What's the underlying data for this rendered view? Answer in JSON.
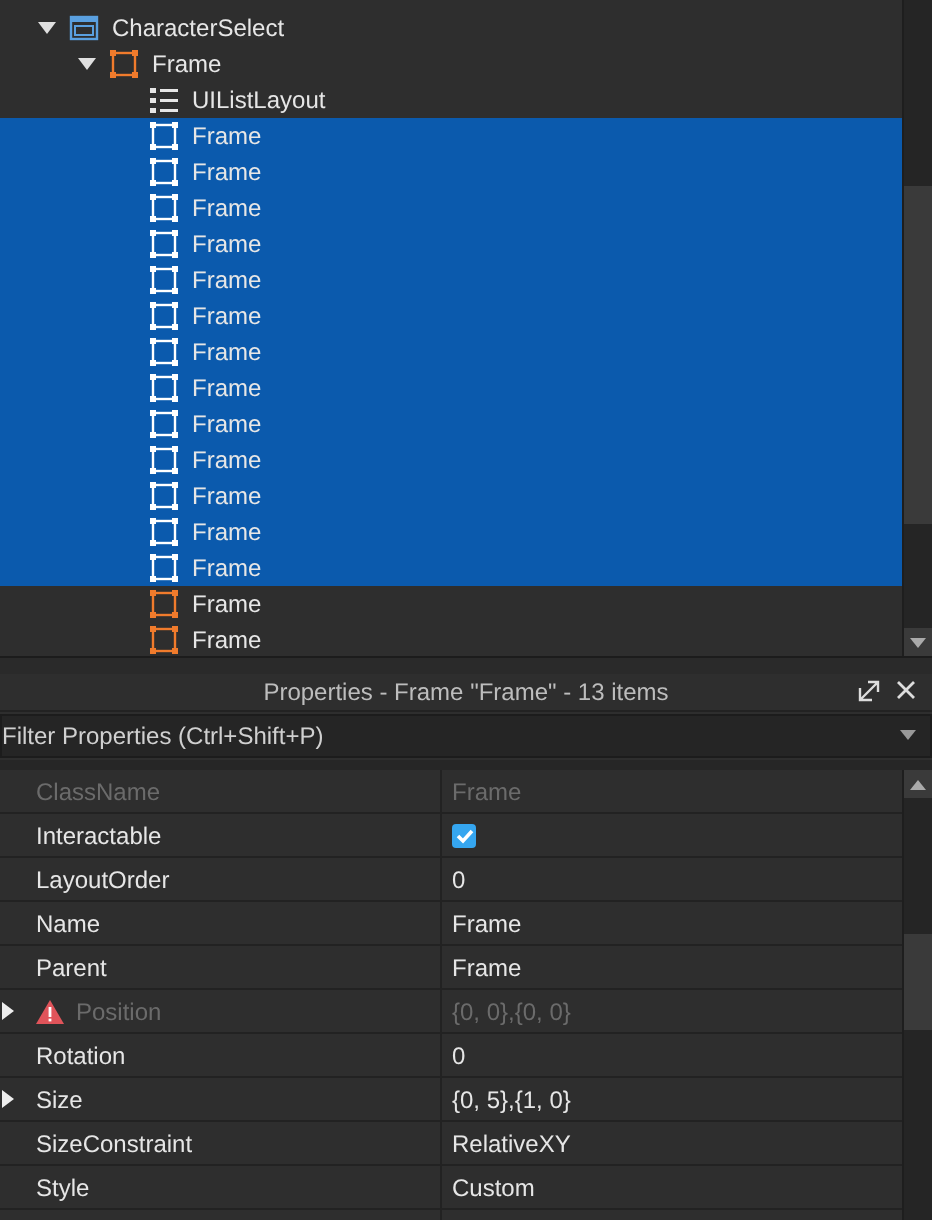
{
  "explorer": {
    "tree": [
      {
        "name": "CharacterSelect",
        "kind": "screen",
        "expanded": true,
        "selected": false,
        "children": [
          {
            "name": "Frame",
            "kind": "frame",
            "expanded": true,
            "selected": false,
            "children": [
              {
                "name": "UIListLayout",
                "kind": "list",
                "selected": false
              },
              {
                "name": "Frame",
                "kind": "frame",
                "selected": true
              },
              {
                "name": "Frame",
                "kind": "frame",
                "selected": true
              },
              {
                "name": "Frame",
                "kind": "frame",
                "selected": true
              },
              {
                "name": "Frame",
                "kind": "frame",
                "selected": true
              },
              {
                "name": "Frame",
                "kind": "frame",
                "selected": true
              },
              {
                "name": "Frame",
                "kind": "frame",
                "selected": true
              },
              {
                "name": "Frame",
                "kind": "frame",
                "selected": true
              },
              {
                "name": "Frame",
                "kind": "frame",
                "selected": true
              },
              {
                "name": "Frame",
                "kind": "frame",
                "selected": true
              },
              {
                "name": "Frame",
                "kind": "frame",
                "selected": true
              },
              {
                "name": "Frame",
                "kind": "frame",
                "selected": true
              },
              {
                "name": "Frame",
                "kind": "frame",
                "selected": true
              },
              {
                "name": "Frame",
                "kind": "frame",
                "selected": true
              },
              {
                "name": "Frame",
                "kind": "frame",
                "selected": false
              },
              {
                "name": "Frame",
                "kind": "frame",
                "selected": false
              }
            ]
          }
        ]
      }
    ]
  },
  "properties": {
    "title": "Properties - Frame \"Frame\" - 13 items",
    "filter": {
      "placeholder": "Filter Properties (Ctrl+Shift+P)"
    },
    "rows": [
      {
        "name": "ClassName",
        "kind": "text",
        "value": "Frame",
        "disabled": true,
        "expandable": false,
        "warning": false
      },
      {
        "name": "Interactable",
        "kind": "checkbox",
        "checked": true,
        "disabled": false,
        "expandable": false,
        "warning": false
      },
      {
        "name": "LayoutOrder",
        "kind": "text",
        "value": "0",
        "disabled": false,
        "expandable": false,
        "warning": false
      },
      {
        "name": "Name",
        "kind": "text",
        "value": "Frame",
        "disabled": false,
        "expandable": false,
        "warning": false
      },
      {
        "name": "Parent",
        "kind": "text",
        "value": "Frame",
        "disabled": false,
        "expandable": false,
        "warning": false
      },
      {
        "name": "Position",
        "kind": "text",
        "value": "{0, 0},{0, 0}",
        "disabled": true,
        "expandable": true,
        "warning": true
      },
      {
        "name": "Rotation",
        "kind": "text",
        "value": "0",
        "disabled": false,
        "expandable": false,
        "warning": false
      },
      {
        "name": "Size",
        "kind": "text",
        "value": "{0, 5},{1, 0}",
        "disabled": false,
        "expandable": true,
        "warning": false
      },
      {
        "name": "SizeConstraint",
        "kind": "text",
        "value": "RelativeXY",
        "disabled": false,
        "expandable": false,
        "warning": false
      },
      {
        "name": "Style",
        "kind": "text",
        "value": "Custom",
        "disabled": false,
        "expandable": false,
        "warning": false
      }
    ]
  }
}
